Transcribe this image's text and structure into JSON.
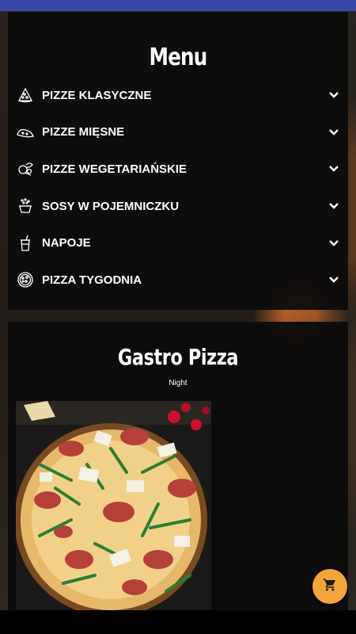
{
  "menu": {
    "title": "Menu",
    "items": [
      {
        "label": "PIZZE KLASYCZNE",
        "icon": "pizza-slice-icon"
      },
      {
        "label": "PIZZE MIĘSNE",
        "icon": "sausage-icon"
      },
      {
        "label": "PIZZE WEGETARIAŃSKIE",
        "icon": "vegetables-icon"
      },
      {
        "label": "SOSY W POJEMNICZKU",
        "icon": "sauce-cup-icon"
      },
      {
        "label": "NAPOJE",
        "icon": "drink-cup-icon"
      },
      {
        "label": "PIZZA TYGODNIA",
        "icon": "pizza-whole-icon"
      }
    ]
  },
  "promo": {
    "title": "Gastro Pizza",
    "subtitle": "Night",
    "image": "pizza-photo"
  },
  "cart": {
    "icon": "cart-icon"
  },
  "colors": {
    "statusbar": "#3949ab",
    "cart_button": "#f4a43a",
    "panel": "#0c0c0c"
  }
}
